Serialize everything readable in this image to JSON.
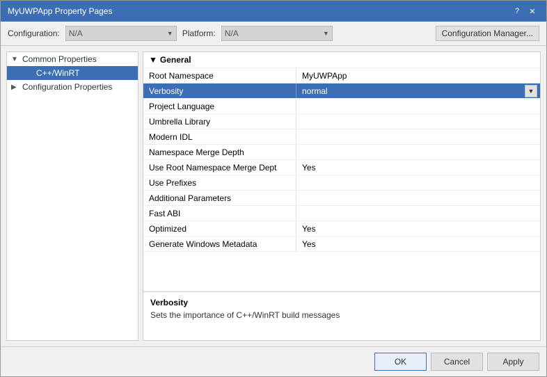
{
  "titleBar": {
    "title": "MyUWPApp Property Pages",
    "helpBtn": "?",
    "closeBtn": "✕"
  },
  "configBar": {
    "configLabel": "Configuration:",
    "configValue": "N/A",
    "platformLabel": "Platform:",
    "platformValue": "N/A",
    "managerBtn": "Configuration Manager..."
  },
  "tree": {
    "items": [
      {
        "id": "common-properties",
        "label": "Common Properties",
        "indent": 0,
        "expandIcon": "▼",
        "selected": false
      },
      {
        "id": "cpp-winrt",
        "label": "C++/WinRT",
        "indent": 1,
        "expandIcon": "",
        "selected": true
      },
      {
        "id": "config-properties",
        "label": "Configuration Properties",
        "indent": 0,
        "expandIcon": "▶",
        "selected": false
      }
    ]
  },
  "propsPanel": {
    "sectionLabel": "General",
    "expandIcon": "▼",
    "properties": [
      {
        "id": "root-namespace",
        "name": "Root Namespace",
        "value": "MyUWPApp",
        "selected": false,
        "hasDropdown": false
      },
      {
        "id": "verbosity",
        "name": "Verbosity",
        "value": "normal",
        "selected": true,
        "hasDropdown": true
      },
      {
        "id": "project-language",
        "name": "Project Language",
        "value": "",
        "selected": false,
        "hasDropdown": false
      },
      {
        "id": "umbrella-library",
        "name": "Umbrella Library",
        "value": "",
        "selected": false,
        "hasDropdown": false
      },
      {
        "id": "modern-idl",
        "name": "Modern IDL",
        "value": "",
        "selected": false,
        "hasDropdown": false
      },
      {
        "id": "namespace-merge-depth",
        "name": "Namespace Merge Depth",
        "value": "",
        "selected": false,
        "hasDropdown": false
      },
      {
        "id": "use-root-namespace",
        "name": "Use Root Namespace Merge Dept",
        "value": "Yes",
        "selected": false,
        "hasDropdown": false
      },
      {
        "id": "use-prefixes",
        "name": "Use Prefixes",
        "value": "",
        "selected": false,
        "hasDropdown": false
      },
      {
        "id": "additional-parameters",
        "name": "Additional Parameters",
        "value": "",
        "selected": false,
        "hasDropdown": false
      },
      {
        "id": "fast-abi",
        "name": "Fast ABI",
        "value": "",
        "selected": false,
        "hasDropdown": false
      },
      {
        "id": "optimized",
        "name": "Optimized",
        "value": "Yes",
        "selected": false,
        "hasDropdown": false
      },
      {
        "id": "generate-windows-metadata",
        "name": "Generate Windows Metadata",
        "value": "Yes",
        "selected": false,
        "hasDropdown": false
      }
    ]
  },
  "descPanel": {
    "title": "Verbosity",
    "description": "Sets the importance of C++/WinRT build messages"
  },
  "buttons": {
    "ok": "OK",
    "cancel": "Cancel",
    "apply": "Apply"
  }
}
